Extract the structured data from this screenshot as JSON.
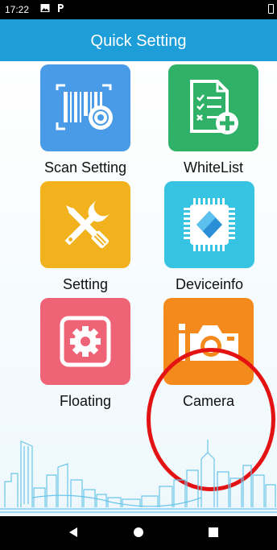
{
  "status_bar": {
    "time": "17:22"
  },
  "header": {
    "title": "Quick Setting"
  },
  "tiles": [
    {
      "label": "Scan Setting",
      "icon": "barcode-gear-icon",
      "color": "#4a9be7"
    },
    {
      "label": "WhiteList",
      "icon": "list-add-icon",
      "color": "#2fb167"
    },
    {
      "label": "Setting",
      "icon": "wrench-screwdriver-icon",
      "color": "#f1b21d"
    },
    {
      "label": "Deviceinfo",
      "icon": "chip-icon",
      "color": "#37c3e2"
    },
    {
      "label": "Floating",
      "icon": "gear-window-icon",
      "color": "#ee6476"
    },
    {
      "label": "Camera",
      "icon": "camera-icon",
      "color": "#f48a1c"
    }
  ],
  "annotation": {
    "highlight_color": "#e41313",
    "highlighted_tile": "Camera"
  },
  "nav_bar": {
    "icons": [
      "back-icon",
      "home-icon",
      "recents-icon"
    ]
  }
}
